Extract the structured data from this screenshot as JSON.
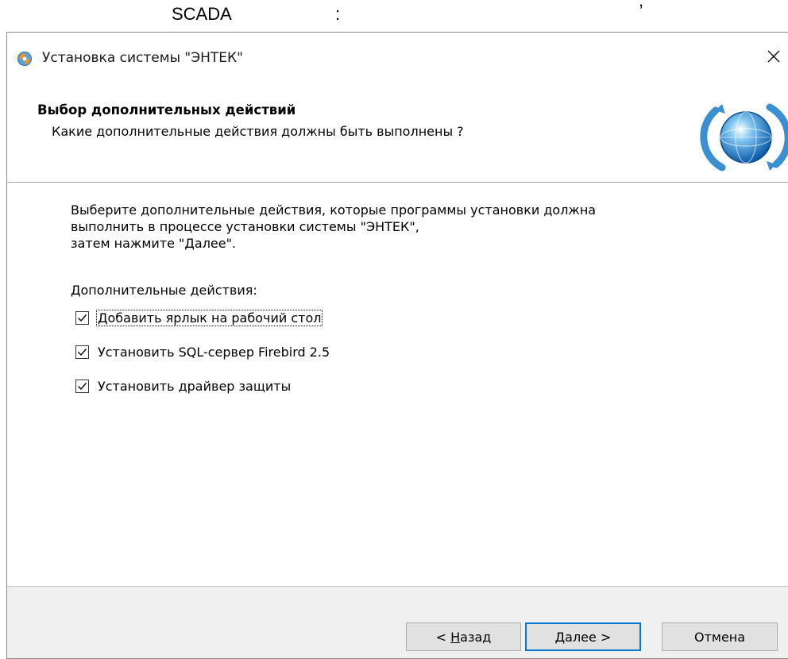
{
  "doc": {
    "fragment_scada": "SCADA",
    "fragment_colon": ":",
    "fragment_comma": ","
  },
  "window": {
    "title": "Установка системы \"ЭНТЕК\""
  },
  "header": {
    "title": "Выбор дополнительных действий",
    "subtitle": "Какие дополнительные действия должны быть выполнены ?"
  },
  "content": {
    "instructions": [
      "Выберите дополнительные действия, которые программы установки должна",
      "выполнить в процессе установки системы \"ЭНТЕК\",",
      "затем нажмите \"Далее\"."
    ],
    "group_label": "Дополнительные действия:",
    "tasks": [
      {
        "label": "Добавить ярлык на рабочий стол",
        "checked": true
      },
      {
        "label": "Установить SQL-сервер Firebird 2.5",
        "checked": true
      },
      {
        "label": "Установить драйвер защиты",
        "checked": true
      }
    ]
  },
  "buttons": {
    "back_prefix": "< ",
    "back_accel": "Н",
    "back_rest": "азад",
    "next_accel": "Д",
    "next_rest": "алее >",
    "cancel": "Отмена"
  },
  "icons": {
    "title": "installer-app-icon",
    "close": "close-icon",
    "logo": "globe-refresh-icon",
    "check": "checkmark-icon"
  },
  "colors": {
    "accent": "#0078d7",
    "window_bg": "#f0f0f0",
    "panel_bg": "#ffffff"
  }
}
